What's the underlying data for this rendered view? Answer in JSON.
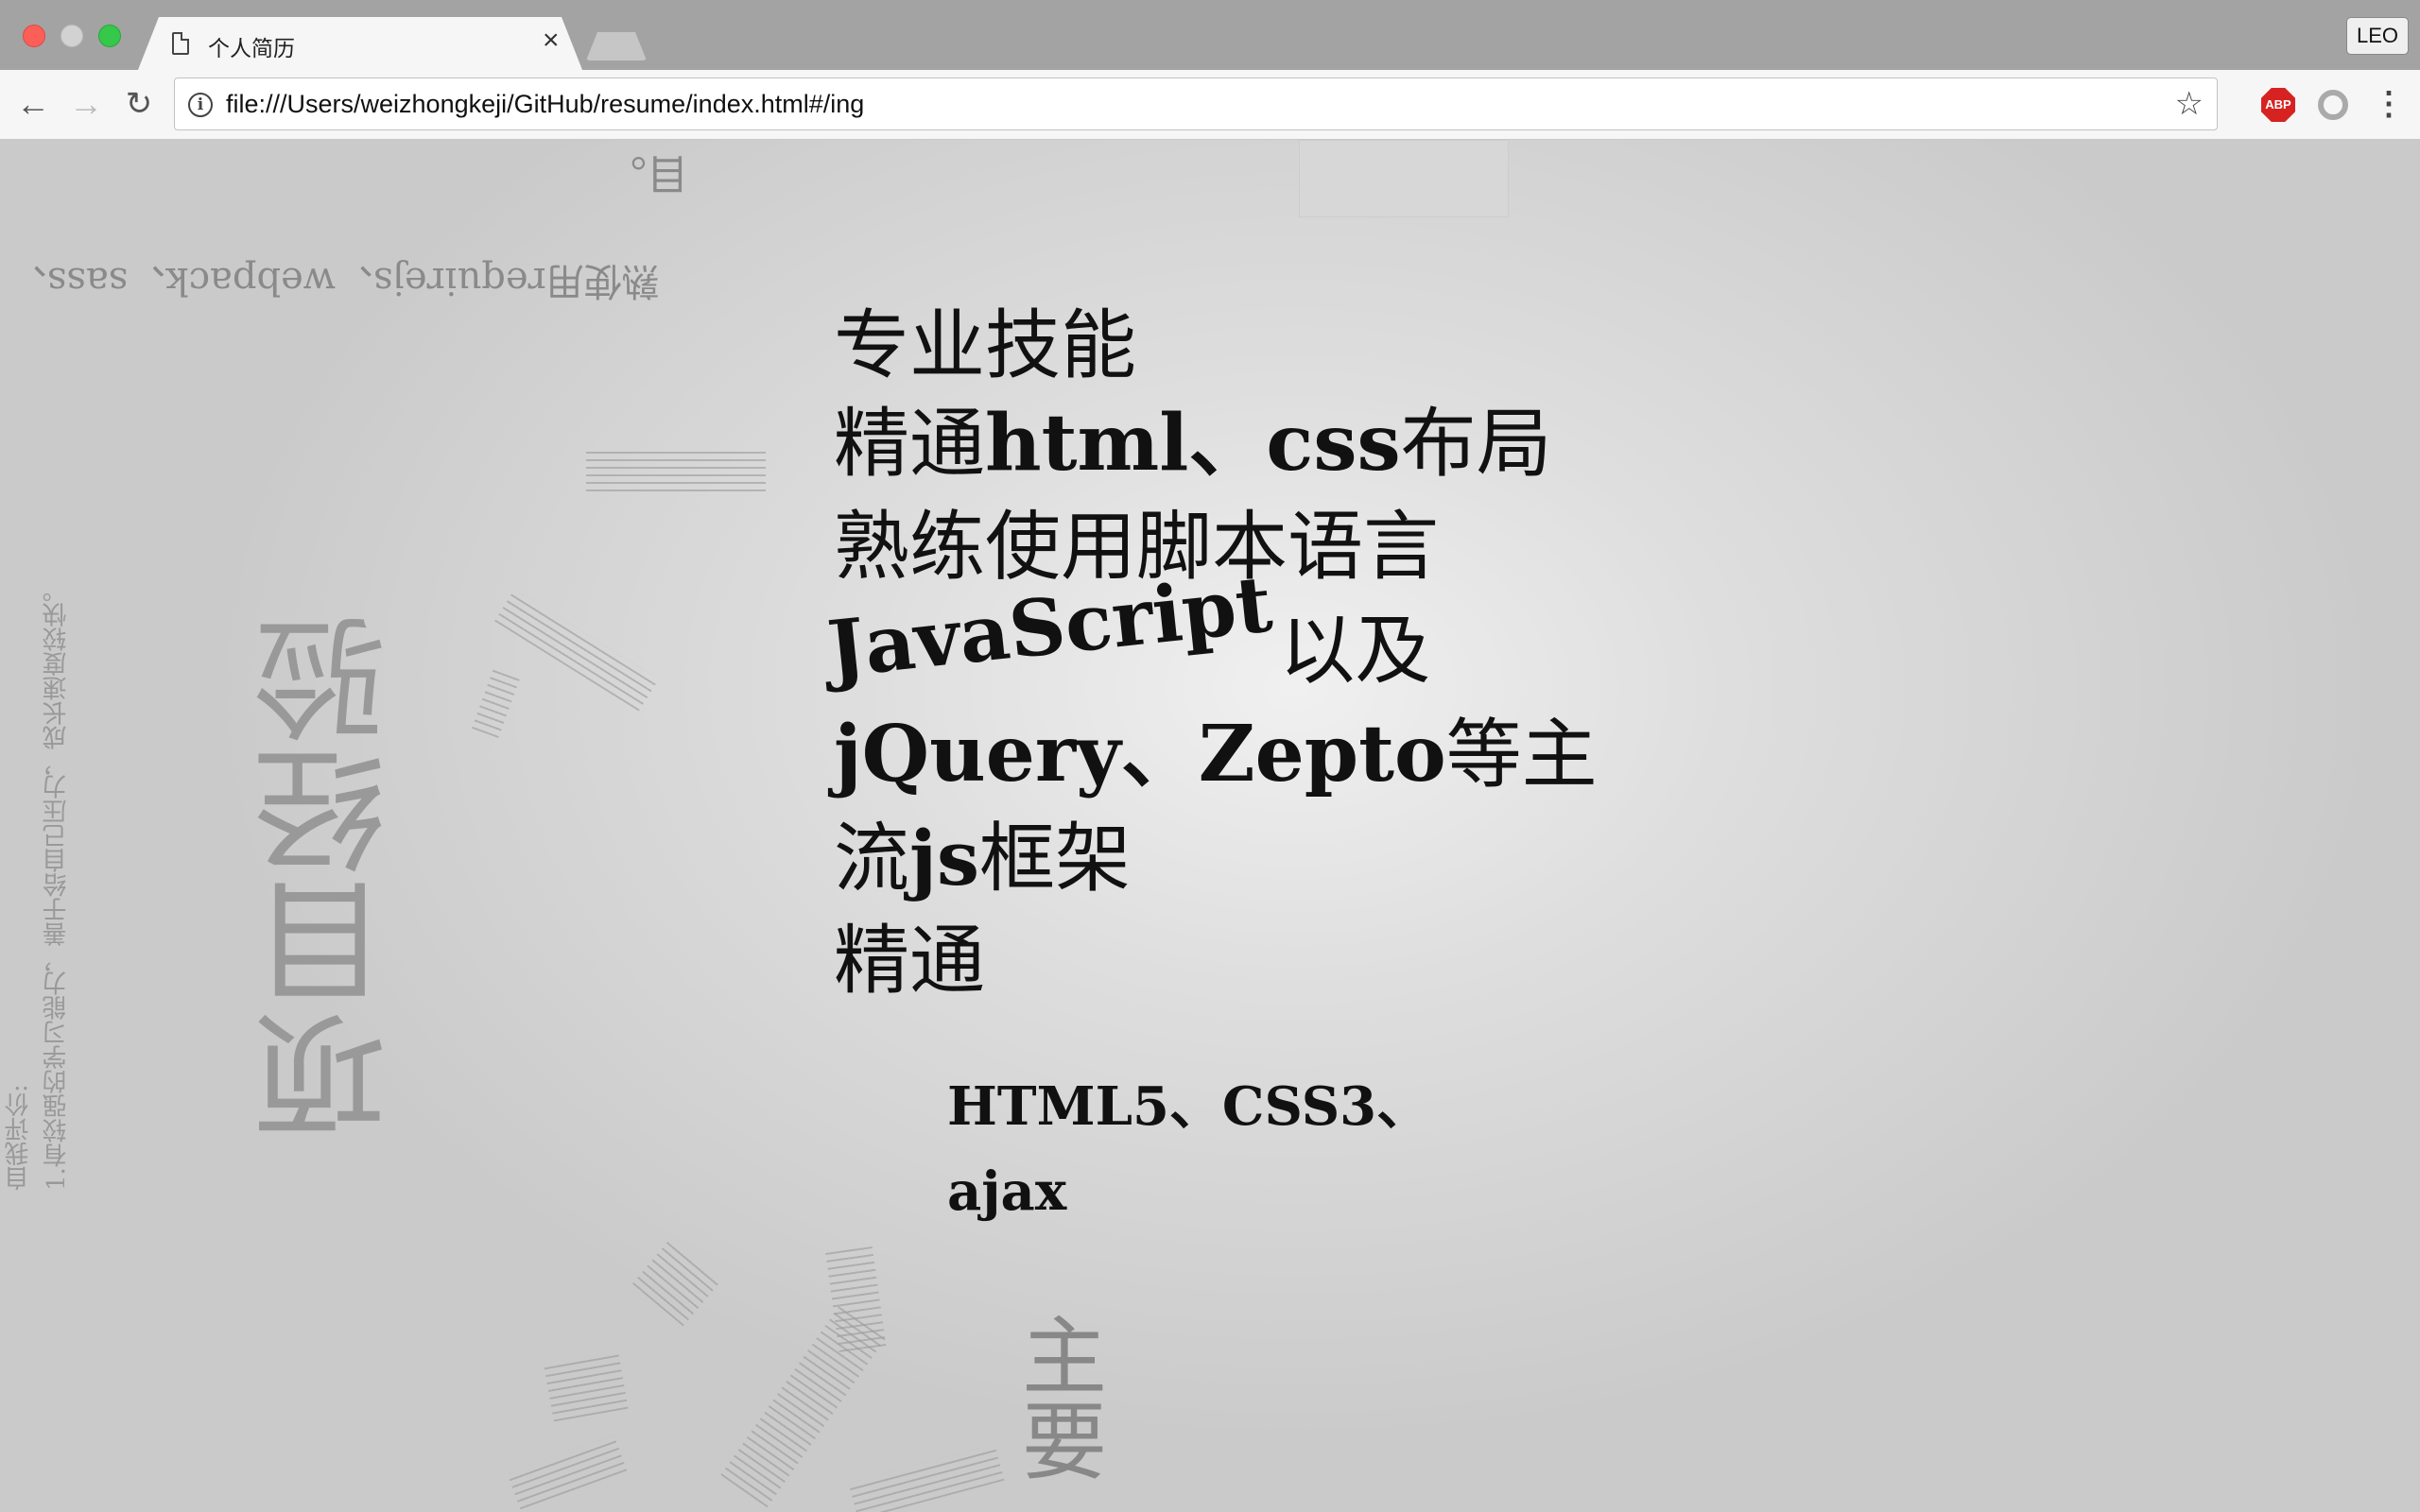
{
  "browser": {
    "tab_title": "个人简历",
    "tab_close": "×",
    "profile": "LEO",
    "url": "file:///Users/weizhongkeji/GitHub/resume/index.html#/ing",
    "abp_label": "ABP",
    "icons": {
      "back": "arrow-left",
      "forward": "arrow-right",
      "reload": "reload",
      "info": "info-circle",
      "star": "star",
      "menu": "kebab"
    }
  },
  "background": {
    "project_title": "项目经验",
    "tools_line": "熟使用requirejs、webpack、sass、",
    "mu": "目。",
    "self_eval_title": "自我评价:",
    "self_eval_text": "1.有较强的学习能力，善于给自己压力，成长速度较快。",
    "zhuyao": "主要"
  },
  "skills": {
    "heading": "专业技能",
    "line1_a": "精通",
    "line1_b": "html、css",
    "line1_c": "布局",
    "line2": "熟练使用脚本语言",
    "line3_a": "JavaScript",
    "line3_b": "以及",
    "line4_a": "jQuery、Zepto",
    "line4_b": "等主",
    "line5_a": "流",
    "line5_b": "js",
    "line5_c": "框架",
    "line6": "精通",
    "sub1": "HTML5、CSS3、",
    "sub2": "ajax"
  }
}
